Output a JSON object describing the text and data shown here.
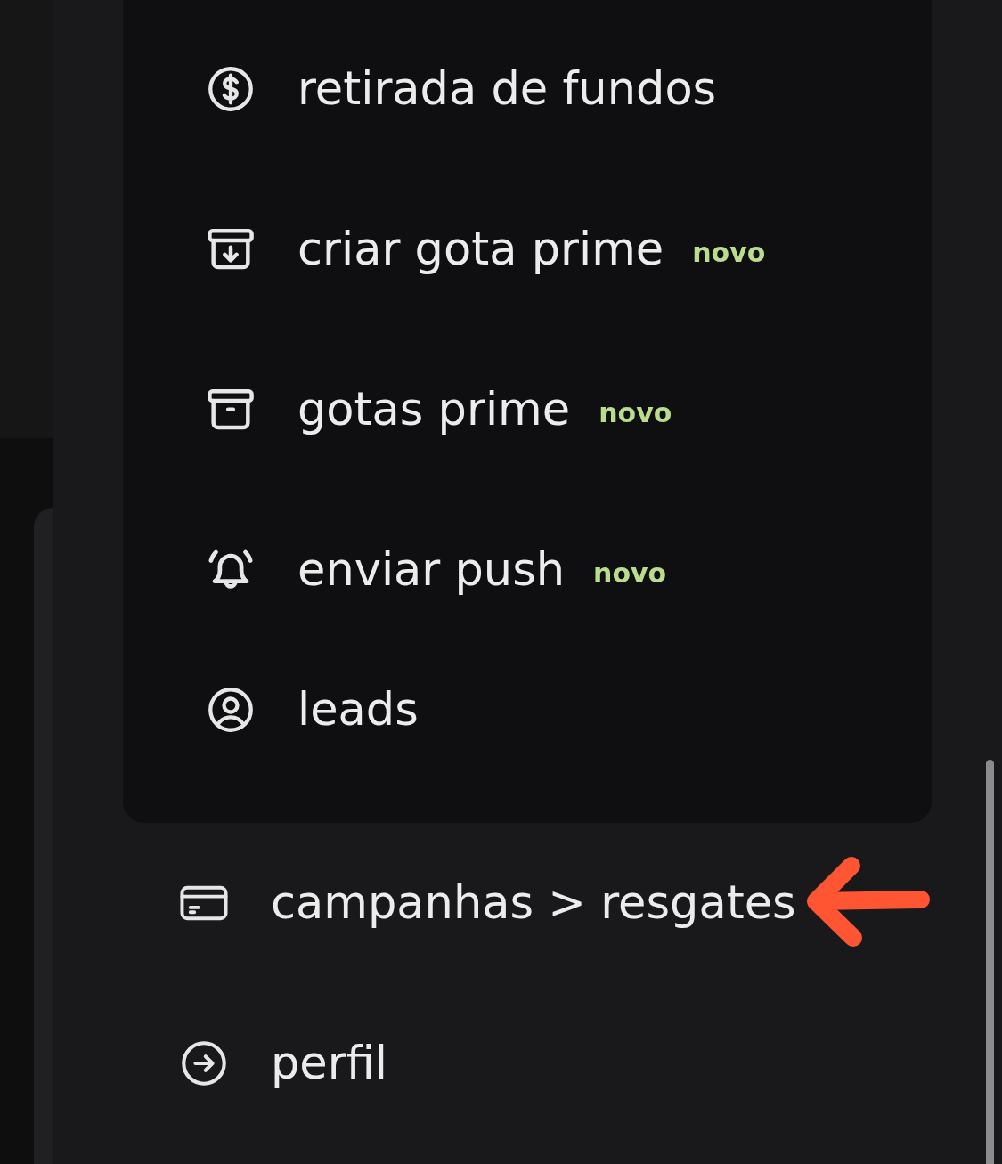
{
  "submenu": {
    "items": [
      {
        "label": "retirada de fundos"
      },
      {
        "label": "criar gota prime",
        "badge": "novo"
      },
      {
        "label": "gotas prime",
        "badge": "novo"
      },
      {
        "label": "enviar push",
        "badge": "novo"
      },
      {
        "label": "leads"
      }
    ]
  },
  "menu": {
    "items": [
      {
        "label": "campanhas > resgates",
        "highlighted": true
      },
      {
        "label": "perfil",
        "highlighted": false
      }
    ]
  }
}
